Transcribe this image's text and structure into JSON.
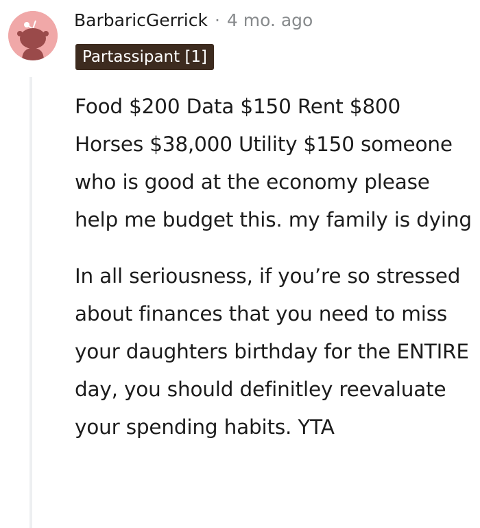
{
  "comment": {
    "author": "BarbaricGerrick",
    "separator": "·",
    "age": "4 mo. ago",
    "flair": "Partassipant [1]",
    "paragraphs": [
      "Food $200 Data $150 Rent $800 Horses $38,000 Utility $150 someone who is good at the economy please help me budget this. my family is dying",
      "In all seriousness, if you’re so stressed about finances that you need to miss your daughters birthday for the ENTIRE day, you should definitley reevaluate your spending habits. YTA"
    ]
  },
  "colors": {
    "avatar_bg": "#f0a8a8",
    "avatar_figure": "#9a4a4a",
    "flair_bg": "#3d2b1f",
    "meta_gray": "#878a8c",
    "thread_line": "#edeff1"
  },
  "icons": {
    "avatar": "reddit-snoo-avatar-icon"
  }
}
